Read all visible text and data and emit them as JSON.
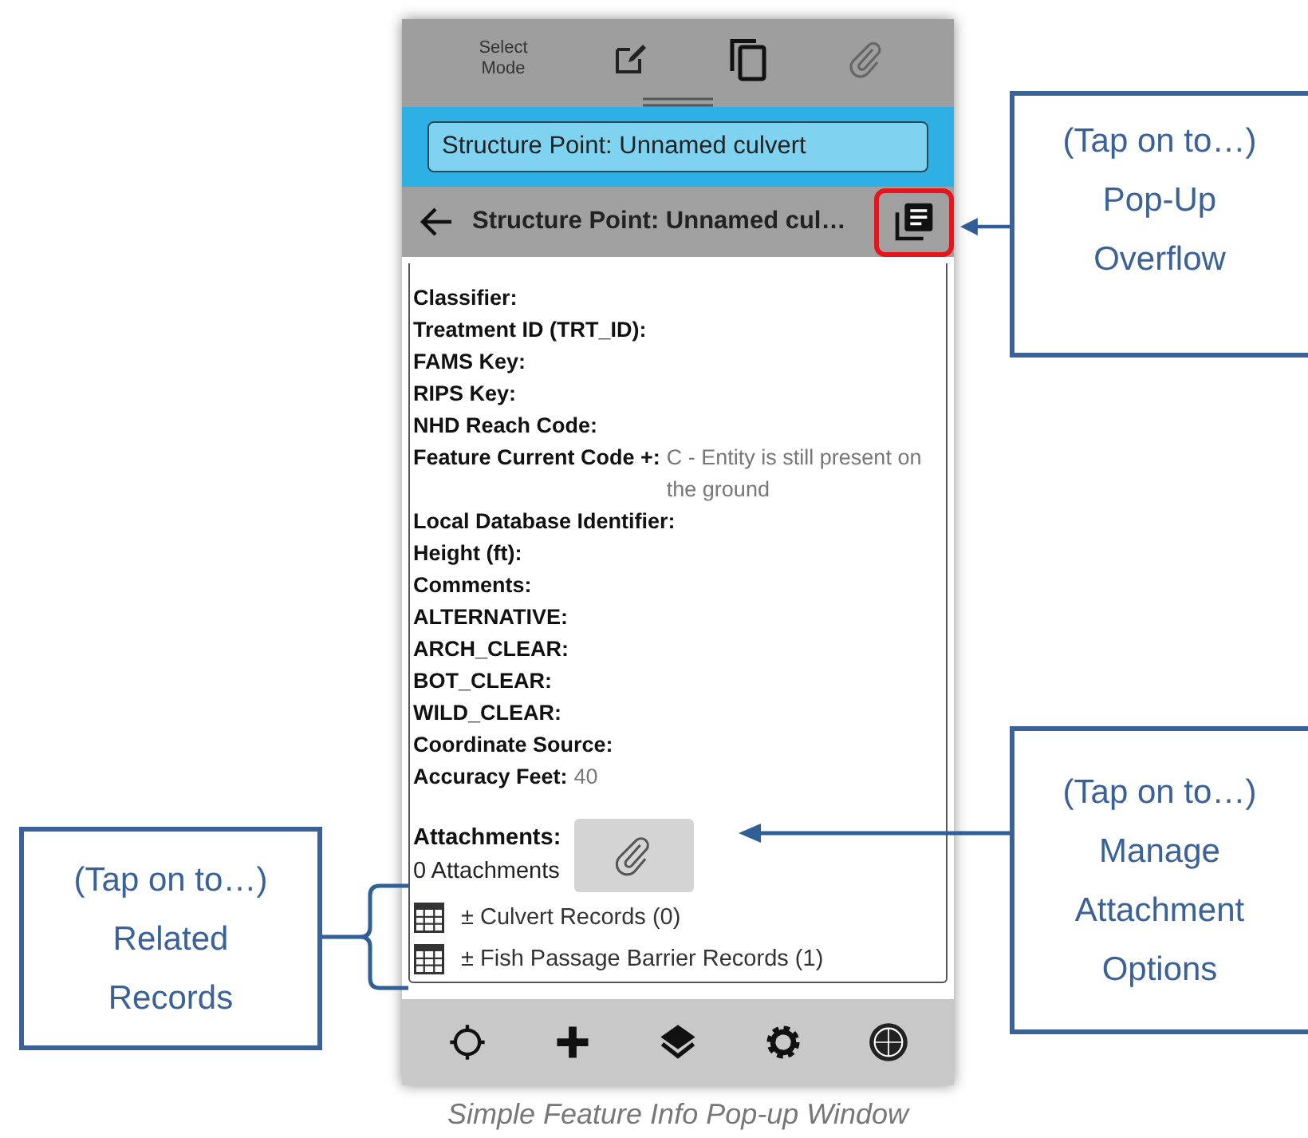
{
  "toolbar": {
    "select_mode": "Select Mode"
  },
  "banner": {
    "value": "Structure Point: Unnamed culvert"
  },
  "header": {
    "title": "Structure Point: Unnamed cul…",
    "overflow_highlighted": true
  },
  "fields": [
    {
      "label": "Classifier:"
    },
    {
      "label": "Treatment ID (TRT_ID):"
    },
    {
      "label": "FAMS Key:"
    },
    {
      "label": "RIPS Key:"
    },
    {
      "label": "NHD Reach Code:"
    },
    {
      "label": "Feature Current Code +:",
      "value": "C - Entity is still present on the ground"
    },
    {
      "label": "Local Database Identifier:"
    },
    {
      "label": "Height (ft):"
    },
    {
      "label": "Comments:"
    },
    {
      "label": "ALTERNATIVE:"
    },
    {
      "label": "ARCH_CLEAR:"
    },
    {
      "label": "BOT_CLEAR:"
    },
    {
      "label": "WILD_CLEAR:"
    },
    {
      "label": "Coordinate Source:"
    },
    {
      "label": "Accuracy Feet:",
      "value": "40"
    }
  ],
  "attachments": {
    "label": "Attachments:",
    "count": "0 Attachments"
  },
  "related_records": [
    "± Culvert Records (0)",
    "± Fish Passage Barrier Records (1)"
  ],
  "callouts": [
    {
      "lines": [
        "(Tap on to…)",
        "Pop-Up",
        "Overflow"
      ]
    },
    {
      "lines": [
        "(Tap on to…)",
        "Manage",
        "Attachment",
        "Options"
      ]
    },
    {
      "lines": [
        "(Tap on to…)",
        "Related",
        "Records"
      ]
    }
  ],
  "caption": "Simple Feature Info Pop-up Window"
}
